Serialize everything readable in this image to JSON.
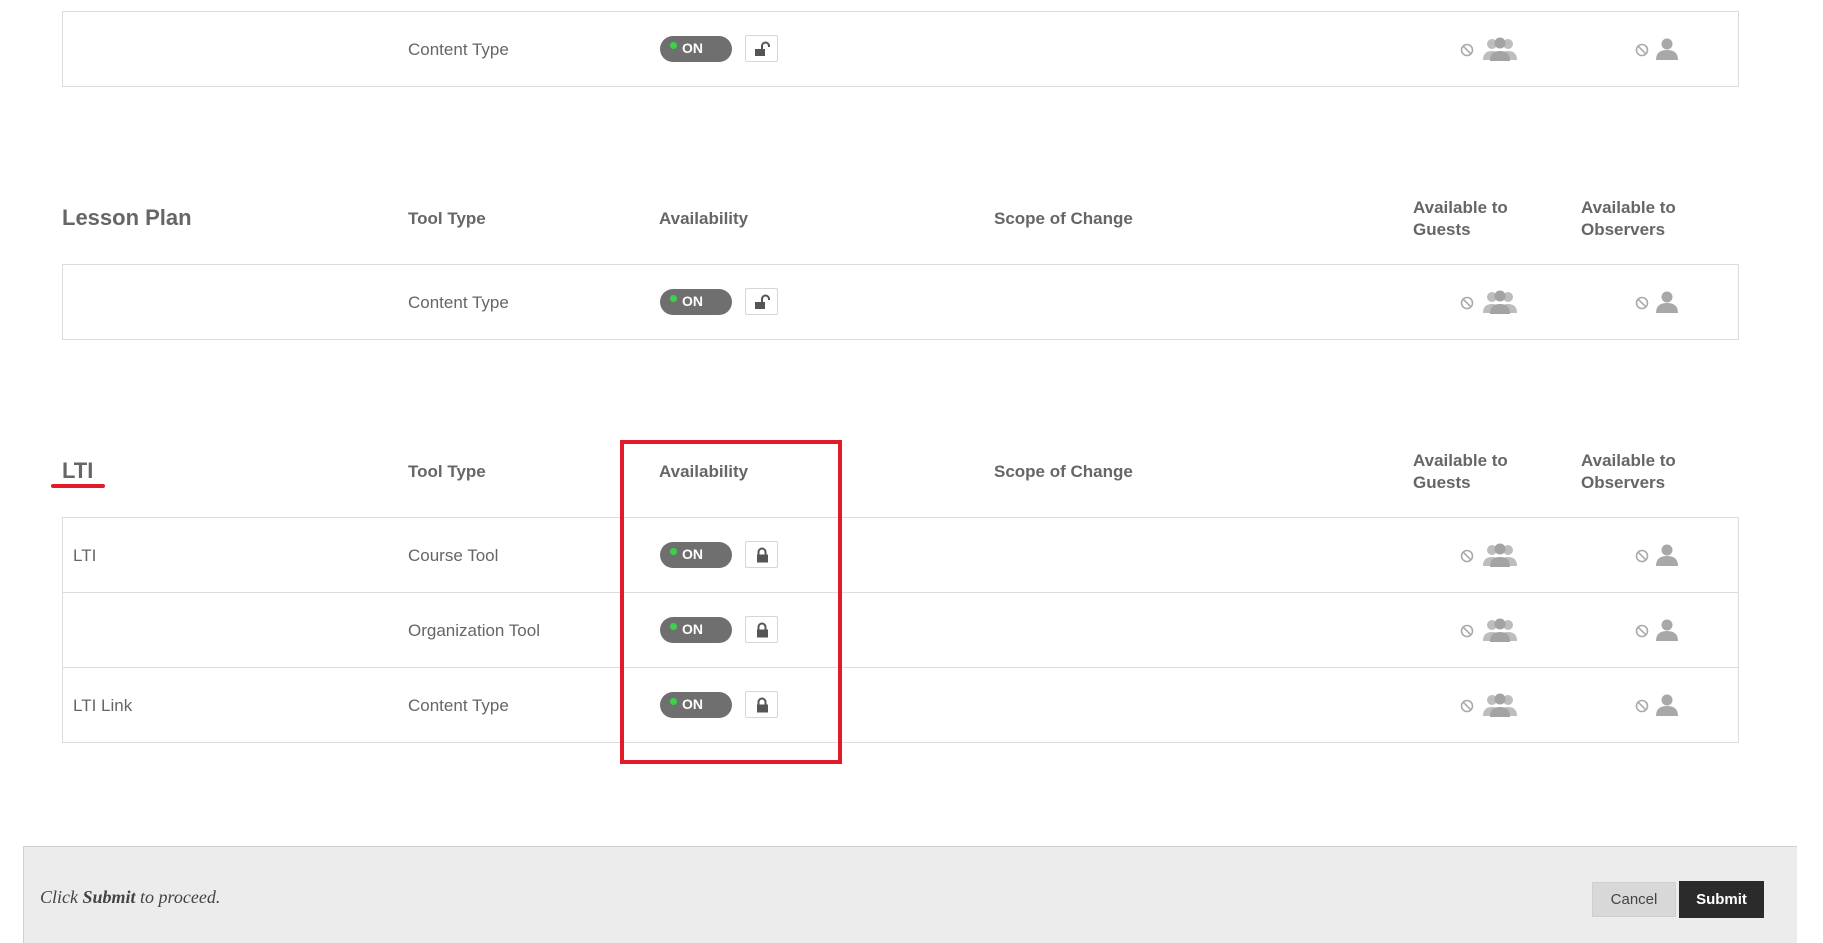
{
  "sections": [
    {
      "title": "",
      "show_header": false,
      "rows": [
        {
          "name": "",
          "tool_type": "Content Type",
          "availability": "ON",
          "locked": false
        }
      ]
    },
    {
      "title": "Lesson Plan",
      "show_header": true,
      "rows": [
        {
          "name": "",
          "tool_type": "Content Type",
          "availability": "ON",
          "locked": false
        }
      ]
    },
    {
      "title": "LTI",
      "show_header": true,
      "rows": [
        {
          "name": "LTI",
          "tool_type": "Course Tool",
          "availability": "ON",
          "locked": true
        },
        {
          "name": "",
          "tool_type": "Organization Tool",
          "availability": "ON",
          "locked": true
        },
        {
          "name": "LTI Link",
          "tool_type": "Content Type",
          "availability": "ON",
          "locked": true
        }
      ]
    }
  ],
  "columns": {
    "tool_type": "Tool Type",
    "availability": "Availability",
    "scope": "Scope of Change",
    "guests_line1": "Available to",
    "guests_line2": "Guests",
    "observers_line1": "Available to",
    "observers_line2": "Observers"
  },
  "footer": {
    "prefix": "Click",
    "bold": "Submit",
    "suffix": "to proceed.",
    "cancel_label": "Cancel",
    "submit_label": "Submit"
  },
  "icons": {
    "unavailable": "no-entry-icon",
    "guests": "group-users-icon",
    "observers": "single-user-icon",
    "lock_open": "unlocked-icon",
    "lock_closed": "locked-icon"
  },
  "colors": {
    "toggle_bg": "#6f6f6f",
    "toggle_dot": "#39d34a",
    "annotation": "#e11b2a",
    "submit_bg": "#2b2b2b"
  }
}
